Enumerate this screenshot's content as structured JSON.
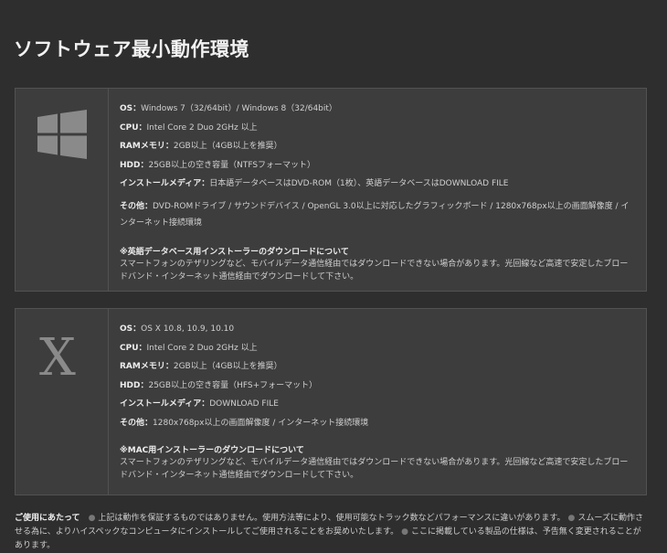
{
  "title": "ソフトウェア最小動作環境",
  "windows": {
    "icon": "windows-logo",
    "specs": [
      {
        "key": "OS：",
        "value": "Windows 7（32/64bit）/ Windows 8（32/64bit）"
      },
      {
        "key": "CPU：",
        "value": "Intel Core 2 Duo 2GHz 以上"
      },
      {
        "key": "RAMメモリ：",
        "value": "2GB以上（4GB以上を推奨）"
      },
      {
        "key": "HDD：",
        "value": "25GB以上の空き容量（NTFSフォーマット）"
      },
      {
        "key": "インストールメディア：",
        "value": "日本語データベースはDVD-ROM（1枚）、英語データベースはDOWNLOAD FILE"
      },
      {
        "key": "その他：",
        "value": "DVD-ROMドライブ / サウンドデバイス / OpenGL 3.0以上に対応したグラフィックボード / 1280x768px以上の画面解像度 / インターネット接続環境"
      }
    ],
    "note_title": "※英語データベース用インストーラーのダウンロードについて",
    "note_body": "スマートフォンのテザリングなど、モバイルデータ通信経由ではダウンロードできない場合があります。光回線など高速で安定したブロードバンド・インターネット通信経由でダウンロードして下さい。"
  },
  "mac": {
    "icon_text": "X",
    "specs": [
      {
        "key": "OS：",
        "value": "OS X 10.8, 10.9, 10.10"
      },
      {
        "key": "CPU：",
        "value": "Intel Core 2 Duo 2GHz 以上"
      },
      {
        "key": "RAMメモリ：",
        "value": "2GB以上（4GB以上を推奨）"
      },
      {
        "key": "HDD：",
        "value": "25GB以上の空き容量（HFS+フォーマット）"
      },
      {
        "key": "インストールメディア：",
        "value": "DOWNLOAD FILE"
      },
      {
        "key": "その他：",
        "value": "1280x768px以上の画面解像度 / インターネット接続環境"
      }
    ],
    "note_title": "※MAC用インストーラーのダウンロードについて",
    "note_body": "スマートフォンのテザリングなど、モバイルデータ通信経由ではダウンロードできない場合があります。光回線など高速で安定したブロードバンド・インターネット通信経由でダウンロードして下さい。"
  },
  "footer": {
    "heading": "ご使用にあたって",
    "bullet": "●",
    "items": [
      "上記は動作を保証するものではありません。使用方法等により、使用可能なトラック数などパフォーマンスに違いがあります。",
      "スムーズに動作させる為に、よりハイスペックなコンピュータにインストールしてご使用されることをお奨めいたします。",
      "ここに掲載している製品の仕様は、予告無く変更されることがあります。"
    ]
  },
  "colors": {
    "background": "#2e2e2e",
    "panel": "#3d3d3d",
    "panel_border": "#525252",
    "icon": "#8a8a8a"
  }
}
